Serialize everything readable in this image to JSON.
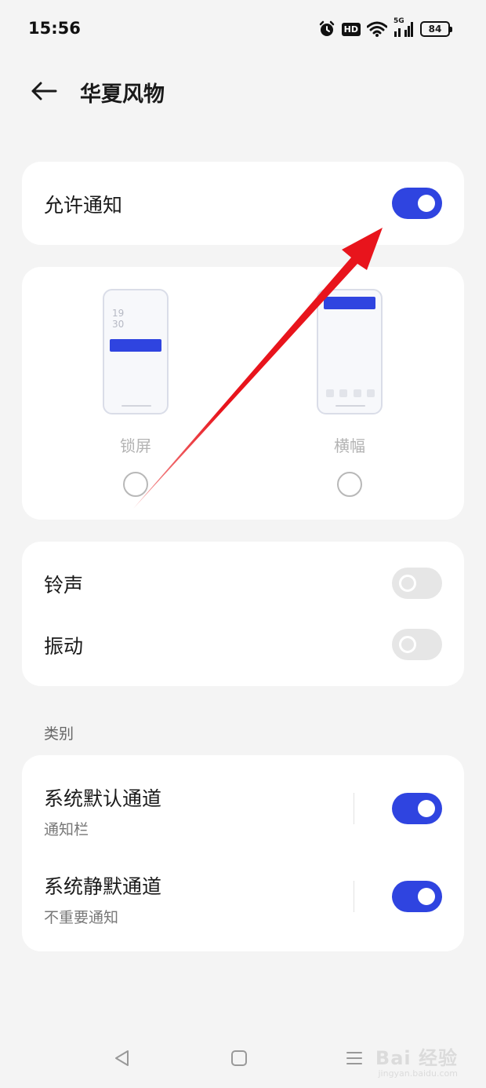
{
  "status_bar": {
    "time": "15:56",
    "hd_label": "HD",
    "network_label": "5G",
    "battery_level": "84",
    "icons": [
      "alarm-icon",
      "hd-icon",
      "wifi-icon",
      "signal-5g-icon",
      "battery-icon"
    ]
  },
  "header": {
    "back_icon": "arrow-left-icon",
    "title": "华夏风物"
  },
  "allow_notifications": {
    "label": "允许通知",
    "enabled": true
  },
  "notification_styles": {
    "options": [
      {
        "label": "锁屏",
        "lock_time_hour": "19",
        "lock_time_minute": "30",
        "selected": false
      },
      {
        "label": "横幅",
        "selected": false
      }
    ]
  },
  "sound_vibration": {
    "items": [
      {
        "label": "铃声",
        "enabled": false
      },
      {
        "label": "振动",
        "enabled": false
      }
    ]
  },
  "categories": {
    "section_title": "类别",
    "items": [
      {
        "label": "系统默认通道",
        "sublabel": "通知栏",
        "enabled": true
      },
      {
        "label": "系统静默通道",
        "sublabel": "不重要通知",
        "enabled": true
      }
    ]
  },
  "nav_bar": {
    "icons": [
      "back-triangle-icon",
      "home-square-icon",
      "menu-lines-icon"
    ]
  },
  "watermark": {
    "main": "Bai 经验",
    "sub": "jingyan.baidu.com"
  },
  "colors": {
    "accent": "#2f44e0",
    "annotation_arrow": "#e8141c",
    "background": "#f4f4f4",
    "card": "#ffffff"
  }
}
